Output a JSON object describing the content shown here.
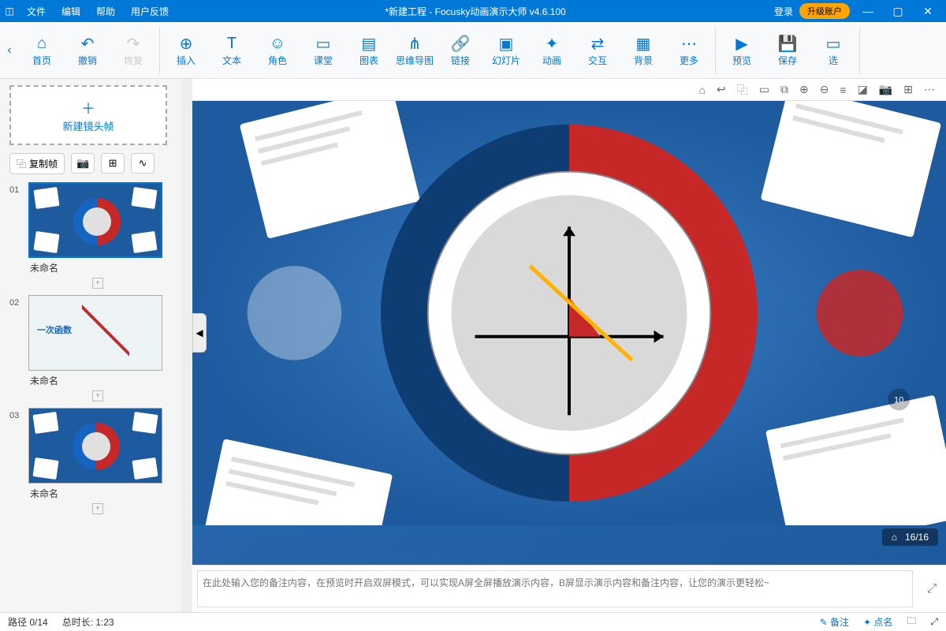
{
  "titlebar": {
    "menus": [
      "文件",
      "编辑",
      "帮助",
      "用户反馈"
    ],
    "title": "*新建工程 - Focusky动画演示大师  v4.6.100",
    "login": "登录",
    "upgrade": "升级账户"
  },
  "toolbar": {
    "home": "首页",
    "undo": "撤销",
    "redo": "恢复",
    "insert": "插入",
    "text": "文本",
    "role": "角色",
    "class": "课堂",
    "chart": "图表",
    "mindmap": "思维导图",
    "link": "链接",
    "slide": "幻灯片",
    "anim": "动画",
    "interact": "交互",
    "bg": "背景",
    "more": "更多",
    "preview": "预览",
    "save": "保存",
    "select": "选"
  },
  "sidebar": {
    "newframe": "新建镜头帧",
    "copyframe": "复制帧",
    "slides": [
      {
        "num": "01",
        "name": "未命名"
      },
      {
        "num": "02",
        "name": "未命名"
      },
      {
        "num": "03",
        "name": "未命名"
      }
    ]
  },
  "canvas": {
    "nav": "16/16"
  },
  "notes": {
    "placeholder": "在此处输入您的备注内容，在预览时开启双屏模式，可以实现A屏全屏播放演示内容，B屏显示演示内容和备注内容，让您的演示更轻松~"
  },
  "status": {
    "path": "路径 0/14",
    "duration": "总时长: 1:23",
    "note": "备注",
    "name": "点名"
  },
  "thumb2": {
    "title": "一次函数"
  }
}
